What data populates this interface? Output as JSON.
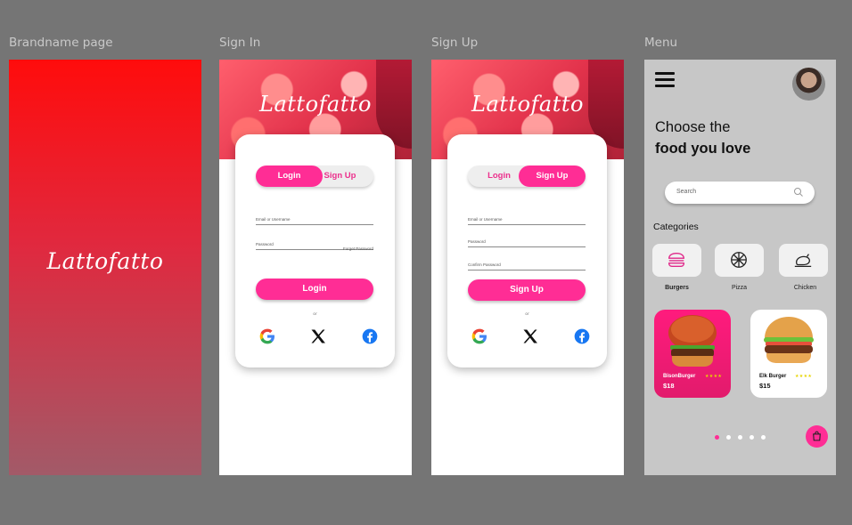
{
  "frames": {
    "brand_label": "Brandname page",
    "signin_label": "Sign In",
    "signup_label": "Sign Up",
    "menu_label": "Menu"
  },
  "brand": {
    "logo": "Lattofatto"
  },
  "signin": {
    "logo": "Lattofatto",
    "tab_login": "Login",
    "tab_signup": "Sign Up",
    "email_placeholder": "Email or Username",
    "password_placeholder": "Password",
    "forgot": "Forget Password",
    "submit": "Login",
    "or": "or"
  },
  "signup": {
    "logo": "Lattofatto",
    "tab_login": "Login",
    "tab_signup": "Sign Up",
    "email_placeholder": "Email or Username",
    "password_placeholder": "Password",
    "confirm_placeholder": "Confirm Password",
    "submit": "Sign Up",
    "or": "or"
  },
  "menu": {
    "title_line1": "Choose the",
    "title_line2": "food you love",
    "search_placeholder": "Search",
    "categories_title": "Categories",
    "categories": [
      {
        "label": "Burgers",
        "icon": "burger-icon",
        "active": true
      },
      {
        "label": "Pizza",
        "icon": "pizza-icon",
        "active": false
      },
      {
        "label": "Chicken",
        "icon": "chicken-icon",
        "active": false
      }
    ],
    "items": [
      {
        "name": "BisonBurger",
        "price": "$18",
        "rating": "★★★★",
        "card_color": "#ff1b7d"
      },
      {
        "name": "Elk Burger",
        "price": "$15",
        "rating": "★★★★",
        "card_color": "#ffffff"
      }
    ],
    "pagination": {
      "pages": 5,
      "current": 1
    }
  },
  "colors": {
    "accent": "#ff2d95",
    "background": "#757575",
    "menu_bg": "#c7c7c7"
  }
}
